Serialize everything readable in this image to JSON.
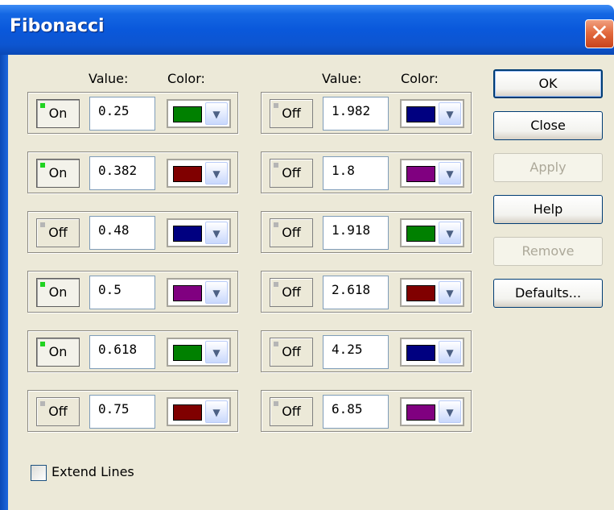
{
  "window": {
    "title": "Fibonacci",
    "close_glyph": "✕"
  },
  "headers": {
    "left_value": "Value:",
    "left_color": "Color:",
    "right_value": "Value:",
    "right_color": "Color:"
  },
  "levels_left": [
    {
      "state": "On",
      "on": true,
      "value": "0.25",
      "color": "#008000",
      "color_name": "green"
    },
    {
      "state": "On",
      "on": true,
      "value": "0.382",
      "color": "#800000",
      "color_name": "maroon"
    },
    {
      "state": "Off",
      "on": false,
      "value": "0.48",
      "color": "#000080",
      "color_name": "navy"
    },
    {
      "state": "On",
      "on": true,
      "value": "0.5",
      "color": "#800080",
      "color_name": "purple"
    },
    {
      "state": "On",
      "on": true,
      "value": "0.618",
      "color": "#008000",
      "color_name": "green"
    },
    {
      "state": "Off",
      "on": false,
      "value": "0.75",
      "color": "#800000",
      "color_name": "maroon"
    }
  ],
  "levels_right": [
    {
      "state": "Off",
      "on": false,
      "value": "1.982",
      "color": "#000080",
      "color_name": "navy"
    },
    {
      "state": "Off",
      "on": false,
      "value": "1.8",
      "color": "#800080",
      "color_name": "purple"
    },
    {
      "state": "Off",
      "on": false,
      "value": "1.918",
      "color": "#008000",
      "color_name": "green"
    },
    {
      "state": "Off",
      "on": false,
      "value": "2.618",
      "color": "#800000",
      "color_name": "maroon"
    },
    {
      "state": "Off",
      "on": false,
      "value": "4.25",
      "color": "#000080",
      "color_name": "navy"
    },
    {
      "state": "Off",
      "on": false,
      "value": "6.85",
      "color": "#800080",
      "color_name": "purple"
    }
  ],
  "buttons": {
    "ok": "OK",
    "close": "Close",
    "apply": "Apply",
    "help": "Help",
    "remove": "Remove",
    "defaults": "Defaults..."
  },
  "extend_lines": {
    "label": "Extend Lines",
    "checked": false
  },
  "icons": {
    "dropdown": "chevron-down-icon",
    "close": "close-icon"
  }
}
